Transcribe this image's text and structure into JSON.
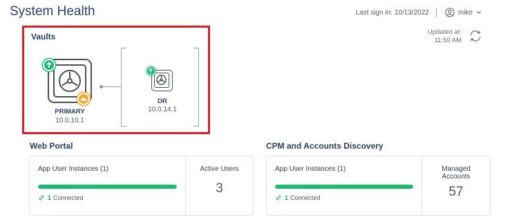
{
  "page": {
    "title": "System Health"
  },
  "header": {
    "last_sign_in": "Last sign in: 10/13/2022",
    "username": "mike"
  },
  "updated": {
    "label": "Updated at:",
    "time": "11:59 AM"
  },
  "vaults": {
    "heading": "Vaults",
    "primary": {
      "name": "PRIMARY",
      "ip": "10.0.10.1"
    },
    "dr": {
      "name": "DR",
      "ip": "10.0.14.1"
    }
  },
  "web_portal": {
    "title": "Web Portal",
    "instances_label": "App User Instances (1)",
    "connected_count": "1",
    "connected_label": "Connected",
    "progress": 1.0,
    "metric_label": "Active Users",
    "metric_value": "3"
  },
  "cpm": {
    "title": "CPM and Accounts Discovery",
    "instances_label": "App User Instances (1)",
    "connected_count": "1",
    "connected_label": "Connected",
    "progress": 1.0,
    "metric_label": "Managed Accounts",
    "metric_value": "57"
  },
  "colors": {
    "accent_green": "#1dba74",
    "highlight_red": "#d6202a",
    "crown_orange": "#f5a623"
  },
  "icons": [
    "user-icon",
    "chevron-down-icon",
    "refresh-icon",
    "vault-icon",
    "arrow-up-icon",
    "crown-icon",
    "link-icon"
  ]
}
